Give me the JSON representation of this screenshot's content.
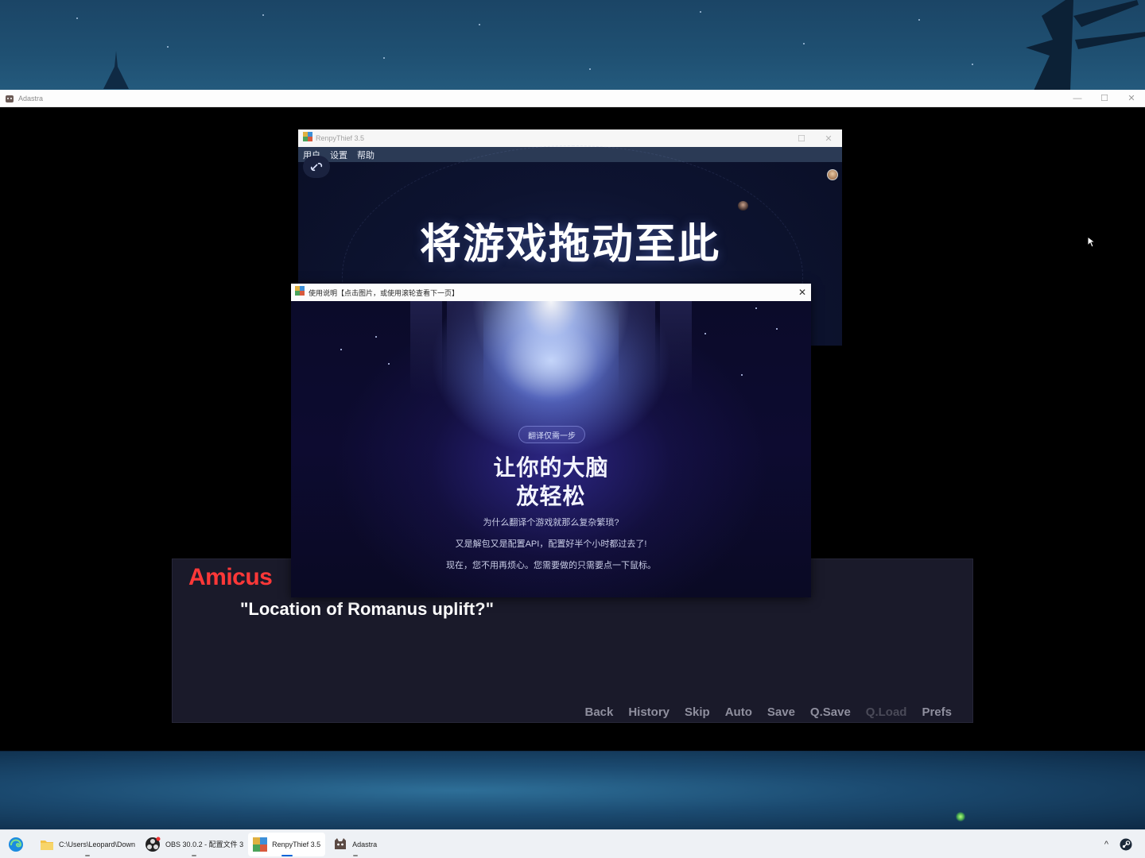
{
  "game_window": {
    "title": "Adastra",
    "controls": {
      "minimize": "—",
      "maximize": "☐",
      "close": "✕"
    }
  },
  "dialogue": {
    "speaker": "Amicus",
    "text": "\"Location of Romanus uplift?\"",
    "speaker_color": "#ff3838"
  },
  "quick_menu": [
    {
      "label": "Back",
      "enabled": true
    },
    {
      "label": "History",
      "enabled": true
    },
    {
      "label": "Skip",
      "enabled": true
    },
    {
      "label": "Auto",
      "enabled": true
    },
    {
      "label": "Save",
      "enabled": true
    },
    {
      "label": "Q.Save",
      "enabled": true
    },
    {
      "label": "Q.Load",
      "enabled": false
    },
    {
      "label": "Prefs",
      "enabled": true
    }
  ],
  "renpythief": {
    "title": "RenpyThief 3.5",
    "menu": [
      "用户",
      "设置",
      "帮助"
    ],
    "drop_text": "将游戏拖动至此"
  },
  "help_window": {
    "title": "使用说明【点击图片，或使用滚轮查看下一页】",
    "close": "✕",
    "badge": "翻译仅需一步",
    "headline_1": "让你的大脑",
    "headline_2": "放轻松",
    "line_1": "为什么翻译个游戏就那么复杂繁琐?",
    "line_2": "又是解包又是配置API，配置好半个小时都过去了!",
    "line_3": "现在，您不用再烦心。您需要做的只需要点一下鼠标。"
  },
  "taskbar": {
    "items": [
      {
        "icon": "edge-icon",
        "label": ""
      },
      {
        "icon": "folder-icon",
        "label": "C:\\Users\\Leopard\\Down"
      },
      {
        "icon": "obs-icon",
        "label": "OBS 30.0.2 - 配置文件 3"
      },
      {
        "icon": "renpythief-icon",
        "label": "RenpyThief 3.5"
      },
      {
        "icon": "adastra-icon",
        "label": "Adastra"
      }
    ],
    "tray": {
      "chevron": "^",
      "steam": "steam-icon"
    }
  }
}
